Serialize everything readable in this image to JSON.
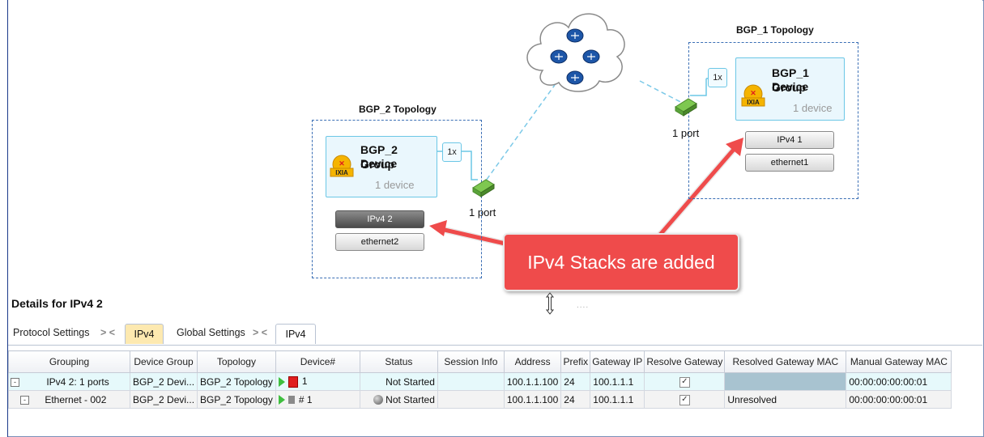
{
  "topologies": {
    "bgp2": {
      "title": "BGP_2 Topology",
      "device_group": {
        "name_line1": "BGP_2 Device",
        "name_line2": "Group",
        "count": "1 device",
        "multiplier": "1x"
      },
      "stacks": [
        "IPv4 2",
        "ethernet2"
      ],
      "port": "1 port"
    },
    "bgp1": {
      "title": "BGP_1 Topology",
      "device_group": {
        "name_line1": "BGP_1 Device",
        "name_line2": "Group",
        "count": "1 device",
        "multiplier": "1x"
      },
      "stacks": [
        "IPv4 1",
        "ethernet1"
      ],
      "port": "1 port"
    }
  },
  "logo_text": "IXIA",
  "callout": {
    "text": "IPv4 Stacks are added",
    "color": "#ef4b4b"
  },
  "details": {
    "title": "Details for IPv4 2",
    "splitter_dots": "....",
    "tabs": {
      "protocol_settings": "Protocol Settings",
      "ipv4_a": "IPv4",
      "global_settings": "Global Settings",
      "ipv4_b": "IPv4",
      "separator": "> <"
    }
  },
  "grid": {
    "columns": [
      "Grouping",
      "Device Group",
      "Topology",
      "Device#",
      "Status",
      "Session Info",
      "Address",
      "Prefix",
      "Gateway IP",
      "Resolve Gateway",
      "Resolved Gateway MAC",
      "Manual Gateway MAC"
    ],
    "rows": [
      {
        "expander": "-",
        "grouping": "IPv4 2: 1 ports",
        "device_group": "BGP_2 Devi...",
        "topology": "BGP_2 Topology",
        "device_num": "1",
        "status": "Not Started",
        "session_info": "",
        "address": "100.1.1.100",
        "prefix": "24",
        "gateway_ip": "100.1.1.1",
        "resolve_gateway": "✓",
        "resolved_gateway_mac": "",
        "manual_gateway_mac": "00:00:00:00:00:01"
      },
      {
        "expander": "-",
        "grouping": "Ethernet - 002",
        "device_group": "BGP_2 Devi...",
        "topology": "BGP_2 Topology",
        "device_num": "# 1",
        "status": "Not Started",
        "session_info": "",
        "address": "100.1.1.100",
        "prefix": "24",
        "gateway_ip": "100.1.1.1",
        "resolve_gateway": "✓",
        "resolved_gateway_mac": "Unresolved",
        "manual_gateway_mac": "00:00:00:00:00:01"
      }
    ]
  },
  "colors": {
    "accent_blue": "#6cc7e6",
    "topology_border": "#3b6fb5",
    "active_tab": "#fde9b0",
    "row_selected": "#e6f9fb",
    "status_red": "#e02020",
    "status_grey": "#8a8a8a",
    "play_green": "#3fbf3f"
  },
  "icons": [
    "cloud-router-icon",
    "ixia-logo-icon",
    "port-icon",
    "play-icon",
    "status-square-icon",
    "status-circle-icon",
    "checkbox-icon",
    "expander-icon",
    "resize-icon"
  ]
}
